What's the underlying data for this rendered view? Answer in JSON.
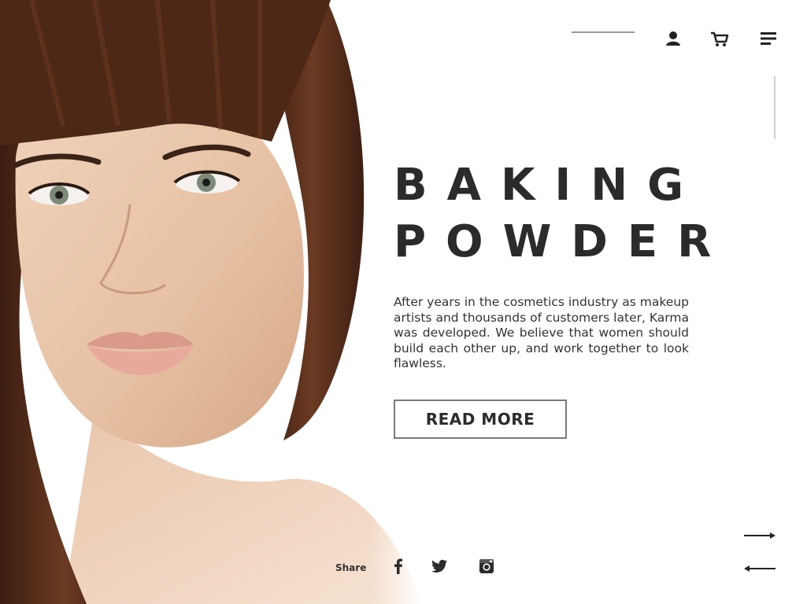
{
  "hero": {
    "title_line1": "BAKING",
    "title_line2": "POWDER",
    "description": "After years in the cosmetics industry as makeup artists and thousands of customers later, Karma was developed. We believe that women should build each other up, and work together to look flawless.",
    "cta_label": "READ MORE"
  },
  "header": {
    "icons": [
      "user-icon",
      "cart-icon",
      "menu-icon"
    ]
  },
  "share": {
    "label": "Share",
    "icons": [
      "facebook-icon",
      "twitter-icon",
      "instagram-icon"
    ]
  },
  "slider": {
    "icons": [
      "arrow-right-icon",
      "arrow-left-icon"
    ]
  },
  "colors": {
    "text": "#2b2b2b",
    "button_border": "#7a7a7a",
    "hair": "#4a2618",
    "skin": "#e8c3a6",
    "background": "#ffffff"
  }
}
